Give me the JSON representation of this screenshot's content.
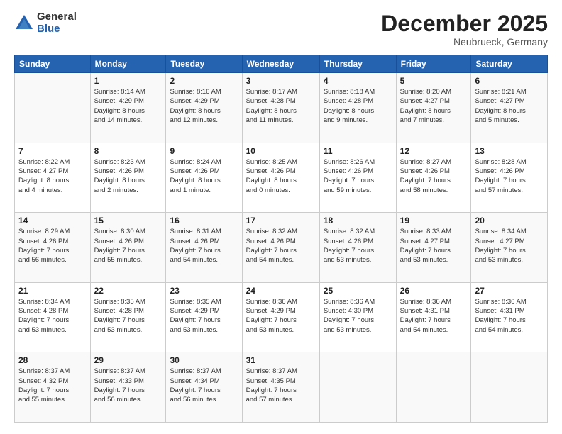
{
  "logo": {
    "general": "General",
    "blue": "Blue"
  },
  "header": {
    "month": "December 2025",
    "location": "Neubrueck, Germany"
  },
  "weekdays": [
    "Sunday",
    "Monday",
    "Tuesday",
    "Wednesday",
    "Thursday",
    "Friday",
    "Saturday"
  ],
  "weeks": [
    [
      {
        "date": "",
        "info": ""
      },
      {
        "date": "1",
        "info": "Sunrise: 8:14 AM\nSunset: 4:29 PM\nDaylight: 8 hours\nand 14 minutes."
      },
      {
        "date": "2",
        "info": "Sunrise: 8:16 AM\nSunset: 4:29 PM\nDaylight: 8 hours\nand 12 minutes."
      },
      {
        "date": "3",
        "info": "Sunrise: 8:17 AM\nSunset: 4:28 PM\nDaylight: 8 hours\nand 11 minutes."
      },
      {
        "date": "4",
        "info": "Sunrise: 8:18 AM\nSunset: 4:28 PM\nDaylight: 8 hours\nand 9 minutes."
      },
      {
        "date": "5",
        "info": "Sunrise: 8:20 AM\nSunset: 4:27 PM\nDaylight: 8 hours\nand 7 minutes."
      },
      {
        "date": "6",
        "info": "Sunrise: 8:21 AM\nSunset: 4:27 PM\nDaylight: 8 hours\nand 5 minutes."
      }
    ],
    [
      {
        "date": "7",
        "info": "Sunrise: 8:22 AM\nSunset: 4:27 PM\nDaylight: 8 hours\nand 4 minutes."
      },
      {
        "date": "8",
        "info": "Sunrise: 8:23 AM\nSunset: 4:26 PM\nDaylight: 8 hours\nand 2 minutes."
      },
      {
        "date": "9",
        "info": "Sunrise: 8:24 AM\nSunset: 4:26 PM\nDaylight: 8 hours\nand 1 minute."
      },
      {
        "date": "10",
        "info": "Sunrise: 8:25 AM\nSunset: 4:26 PM\nDaylight: 8 hours\nand 0 minutes."
      },
      {
        "date": "11",
        "info": "Sunrise: 8:26 AM\nSunset: 4:26 PM\nDaylight: 7 hours\nand 59 minutes."
      },
      {
        "date": "12",
        "info": "Sunrise: 8:27 AM\nSunset: 4:26 PM\nDaylight: 7 hours\nand 58 minutes."
      },
      {
        "date": "13",
        "info": "Sunrise: 8:28 AM\nSunset: 4:26 PM\nDaylight: 7 hours\nand 57 minutes."
      }
    ],
    [
      {
        "date": "14",
        "info": "Sunrise: 8:29 AM\nSunset: 4:26 PM\nDaylight: 7 hours\nand 56 minutes."
      },
      {
        "date": "15",
        "info": "Sunrise: 8:30 AM\nSunset: 4:26 PM\nDaylight: 7 hours\nand 55 minutes."
      },
      {
        "date": "16",
        "info": "Sunrise: 8:31 AM\nSunset: 4:26 PM\nDaylight: 7 hours\nand 54 minutes."
      },
      {
        "date": "17",
        "info": "Sunrise: 8:32 AM\nSunset: 4:26 PM\nDaylight: 7 hours\nand 54 minutes."
      },
      {
        "date": "18",
        "info": "Sunrise: 8:32 AM\nSunset: 4:26 PM\nDaylight: 7 hours\nand 53 minutes."
      },
      {
        "date": "19",
        "info": "Sunrise: 8:33 AM\nSunset: 4:27 PM\nDaylight: 7 hours\nand 53 minutes."
      },
      {
        "date": "20",
        "info": "Sunrise: 8:34 AM\nSunset: 4:27 PM\nDaylight: 7 hours\nand 53 minutes."
      }
    ],
    [
      {
        "date": "21",
        "info": "Sunrise: 8:34 AM\nSunset: 4:28 PM\nDaylight: 7 hours\nand 53 minutes."
      },
      {
        "date": "22",
        "info": "Sunrise: 8:35 AM\nSunset: 4:28 PM\nDaylight: 7 hours\nand 53 minutes."
      },
      {
        "date": "23",
        "info": "Sunrise: 8:35 AM\nSunset: 4:29 PM\nDaylight: 7 hours\nand 53 minutes."
      },
      {
        "date": "24",
        "info": "Sunrise: 8:36 AM\nSunset: 4:29 PM\nDaylight: 7 hours\nand 53 minutes."
      },
      {
        "date": "25",
        "info": "Sunrise: 8:36 AM\nSunset: 4:30 PM\nDaylight: 7 hours\nand 53 minutes."
      },
      {
        "date": "26",
        "info": "Sunrise: 8:36 AM\nSunset: 4:31 PM\nDaylight: 7 hours\nand 54 minutes."
      },
      {
        "date": "27",
        "info": "Sunrise: 8:36 AM\nSunset: 4:31 PM\nDaylight: 7 hours\nand 54 minutes."
      }
    ],
    [
      {
        "date": "28",
        "info": "Sunrise: 8:37 AM\nSunset: 4:32 PM\nDaylight: 7 hours\nand 55 minutes."
      },
      {
        "date": "29",
        "info": "Sunrise: 8:37 AM\nSunset: 4:33 PM\nDaylight: 7 hours\nand 56 minutes."
      },
      {
        "date": "30",
        "info": "Sunrise: 8:37 AM\nSunset: 4:34 PM\nDaylight: 7 hours\nand 56 minutes."
      },
      {
        "date": "31",
        "info": "Sunrise: 8:37 AM\nSunset: 4:35 PM\nDaylight: 7 hours\nand 57 minutes."
      },
      {
        "date": "",
        "info": ""
      },
      {
        "date": "",
        "info": ""
      },
      {
        "date": "",
        "info": ""
      }
    ]
  ]
}
